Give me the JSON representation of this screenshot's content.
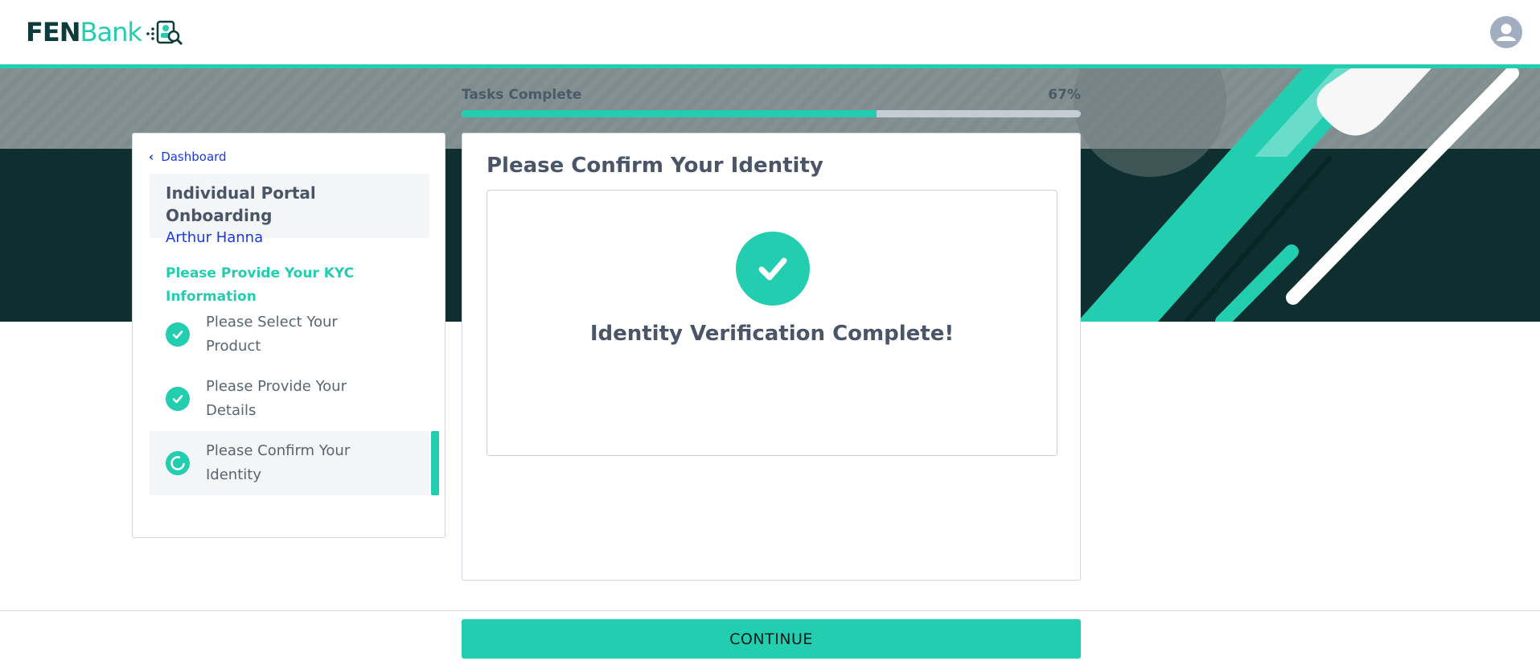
{
  "brand": {
    "part1": "FEN",
    "part2": "Bank",
    "accent": "#22cdb0",
    "dark": "#0b3b3b"
  },
  "header": {
    "avatar_icon": "user-avatar-icon"
  },
  "progress": {
    "label": "Tasks Complete",
    "percent_text": "67%",
    "value": 0.67
  },
  "sidebar": {
    "back_label": "Dashboard",
    "portal_title": "Individual Portal Onboarding",
    "user_name": "Arthur Hanna",
    "section_title": "Please Provide Your KYC Information",
    "steps": [
      {
        "label": "Please Select Your Product",
        "status": "complete"
      },
      {
        "label": "Please Provide Your Details",
        "status": "complete"
      },
      {
        "label": "Please Confirm Your Identity",
        "status": "in-progress"
      }
    ]
  },
  "main": {
    "title": "Please Confirm Your Identity",
    "status_text": "Identity Verification Complete!"
  },
  "footer": {
    "continue_label": "CONTINUE"
  }
}
